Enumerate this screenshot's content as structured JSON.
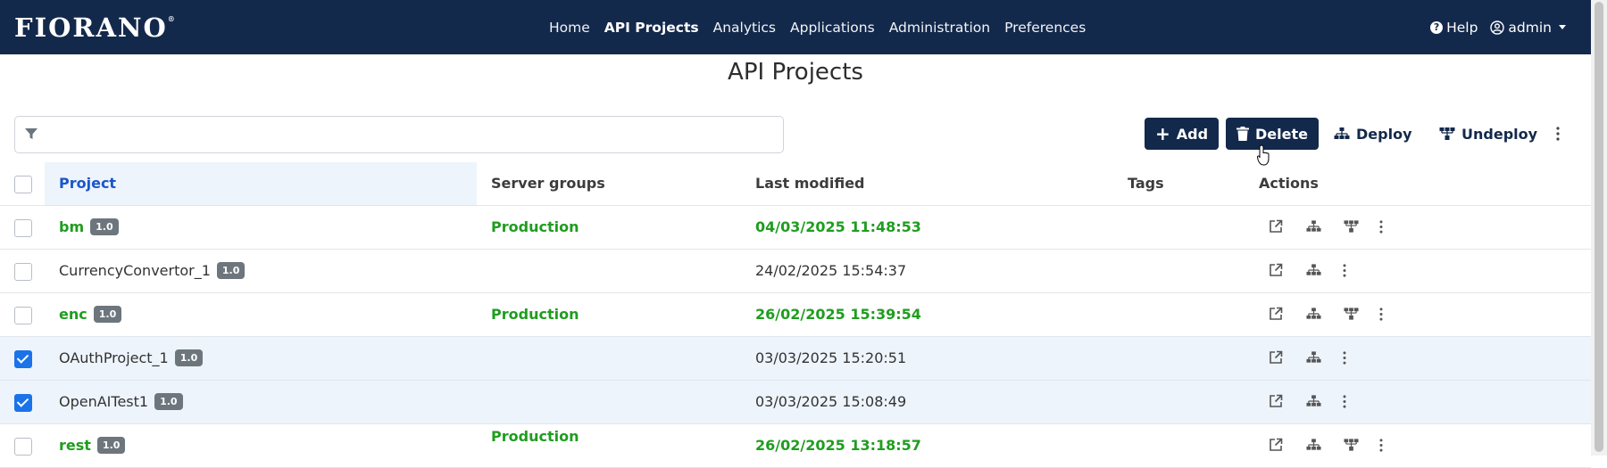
{
  "app": {
    "logo_text": "FIORANO"
  },
  "nav": {
    "links": [
      "Home",
      "API Projects",
      "Analytics",
      "Applications",
      "Administration",
      "Preferences"
    ],
    "active": "API Projects",
    "help_label": "Help",
    "user_label": "admin"
  },
  "page": {
    "title": "API Projects"
  },
  "toolbar": {
    "filter_placeholder": "",
    "add_label": "Add",
    "delete_label": "Delete",
    "deploy_label": "Deploy",
    "undeploy_label": "Undeploy"
  },
  "table": {
    "headers": {
      "project": "Project",
      "server_groups": "Server groups",
      "last_modified": "Last modified",
      "tags": "Tags",
      "actions": "Actions"
    },
    "rows": [
      {
        "name": "bm",
        "version": "1.0",
        "server_group": "Production",
        "last_modified": "04/03/2025 11:48:53",
        "deployed": true,
        "selected": false
      },
      {
        "name": "CurrencyConvertor_1",
        "version": "1.0",
        "server_group": "",
        "last_modified": "24/02/2025 15:54:37",
        "deployed": false,
        "selected": false
      },
      {
        "name": "enc",
        "version": "1.0",
        "server_group": "Production",
        "last_modified": "26/02/2025 15:39:54",
        "deployed": true,
        "selected": false
      },
      {
        "name": "OAuthProject_1",
        "version": "1.0",
        "server_group": "",
        "last_modified": "03/03/2025 15:20:51",
        "deployed": false,
        "selected": true
      },
      {
        "name": "OpenAITest1",
        "version": "1.0",
        "server_group": "",
        "last_modified": "03/03/2025 15:08:49",
        "deployed": false,
        "selected": true
      },
      {
        "name": "rest",
        "version": "1.0",
        "server_group": "Production",
        "last_modified": "26/02/2025 13:18:57",
        "deployed": true,
        "selected": false
      }
    ]
  },
  "colors": {
    "navbar": "#13294b",
    "deployed_text": "#1f9d1f",
    "selected_row": "#eef4fc",
    "checkbox_checked": "#1a73e8",
    "badge": "#6d757d"
  }
}
